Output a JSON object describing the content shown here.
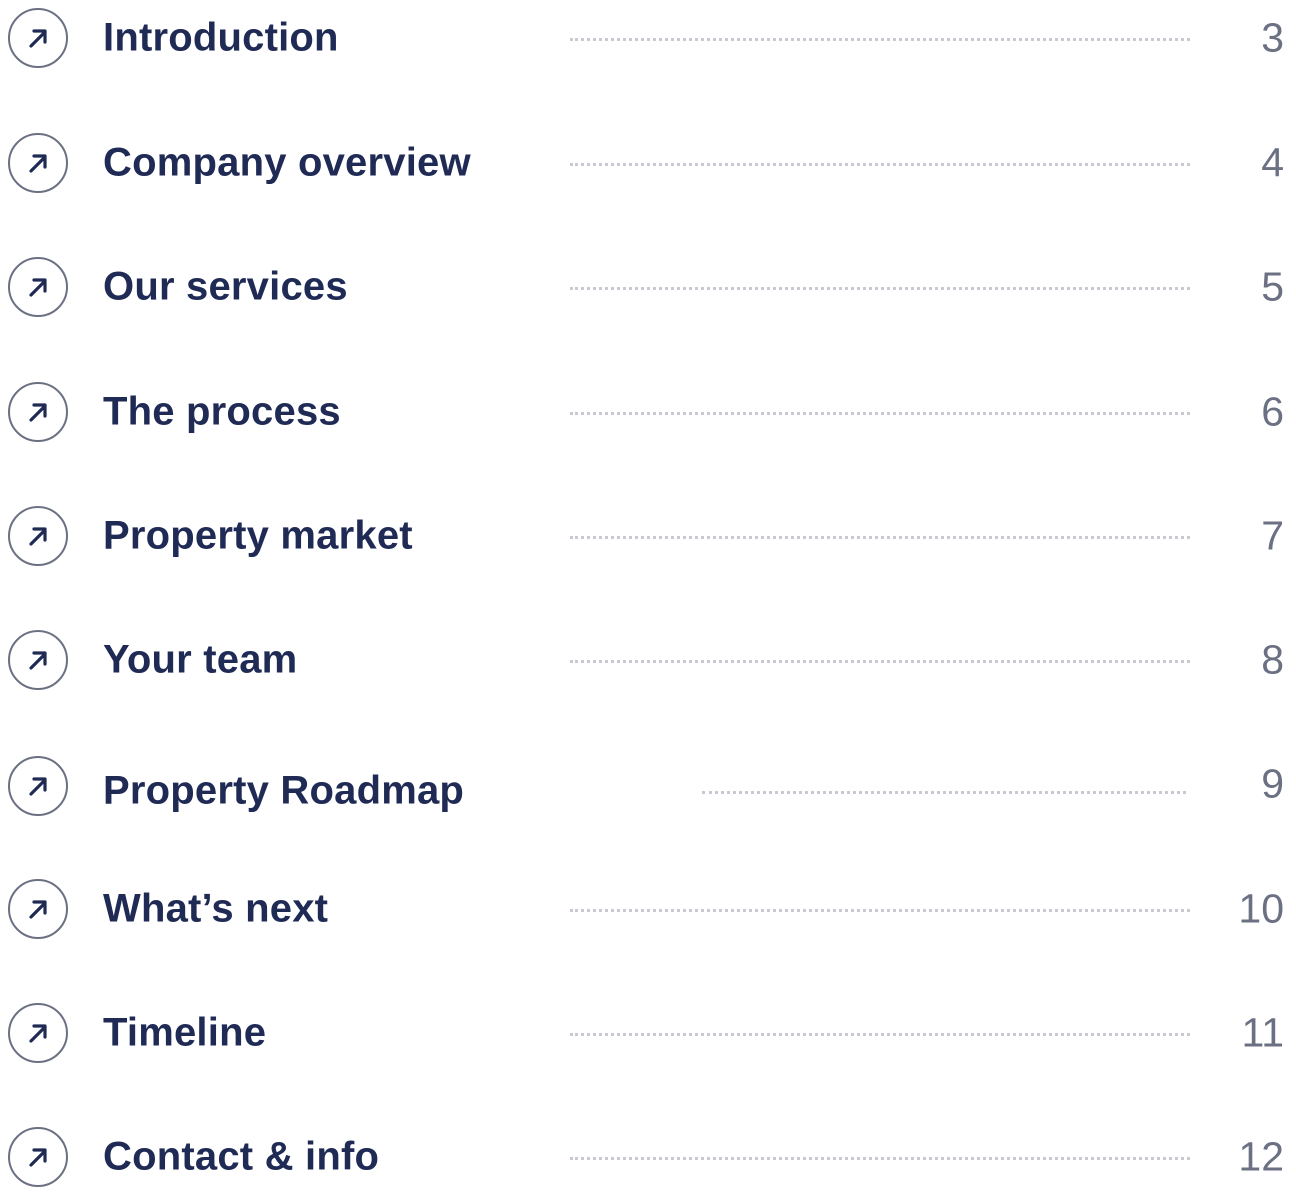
{
  "toc": {
    "items": [
      {
        "title": "Introduction",
        "page": "3",
        "icon": "arrow-up-right-icon"
      },
      {
        "title": "Company overview",
        "page": "4",
        "icon": "arrow-up-right-icon"
      },
      {
        "title": "Our services",
        "page": "5",
        "icon": "arrow-up-right-icon"
      },
      {
        "title": "The process",
        "page": "6",
        "icon": "arrow-up-right-icon"
      },
      {
        "title": "Property market",
        "page": "7",
        "icon": "arrow-up-right-icon"
      },
      {
        "title": "Your team",
        "page": "8",
        "icon": "arrow-up-right-icon"
      },
      {
        "title": "Property Roadmap",
        "page": "9",
        "icon": "arrow-up-right-icon"
      },
      {
        "title": "What’s next",
        "page": "10",
        "icon": "arrow-up-right-icon"
      },
      {
        "title": "Timeline",
        "page": "11",
        "icon": "arrow-up-right-icon"
      },
      {
        "title": "Contact & info",
        "page": "12",
        "icon": "arrow-up-right-icon"
      }
    ]
  },
  "colors": {
    "title": "#1f2a55",
    "page_number": "#6b7183",
    "leader_dots": "#c7cad2",
    "icon_outline": "#6b7183",
    "icon_arrow": "#1f2a55"
  }
}
